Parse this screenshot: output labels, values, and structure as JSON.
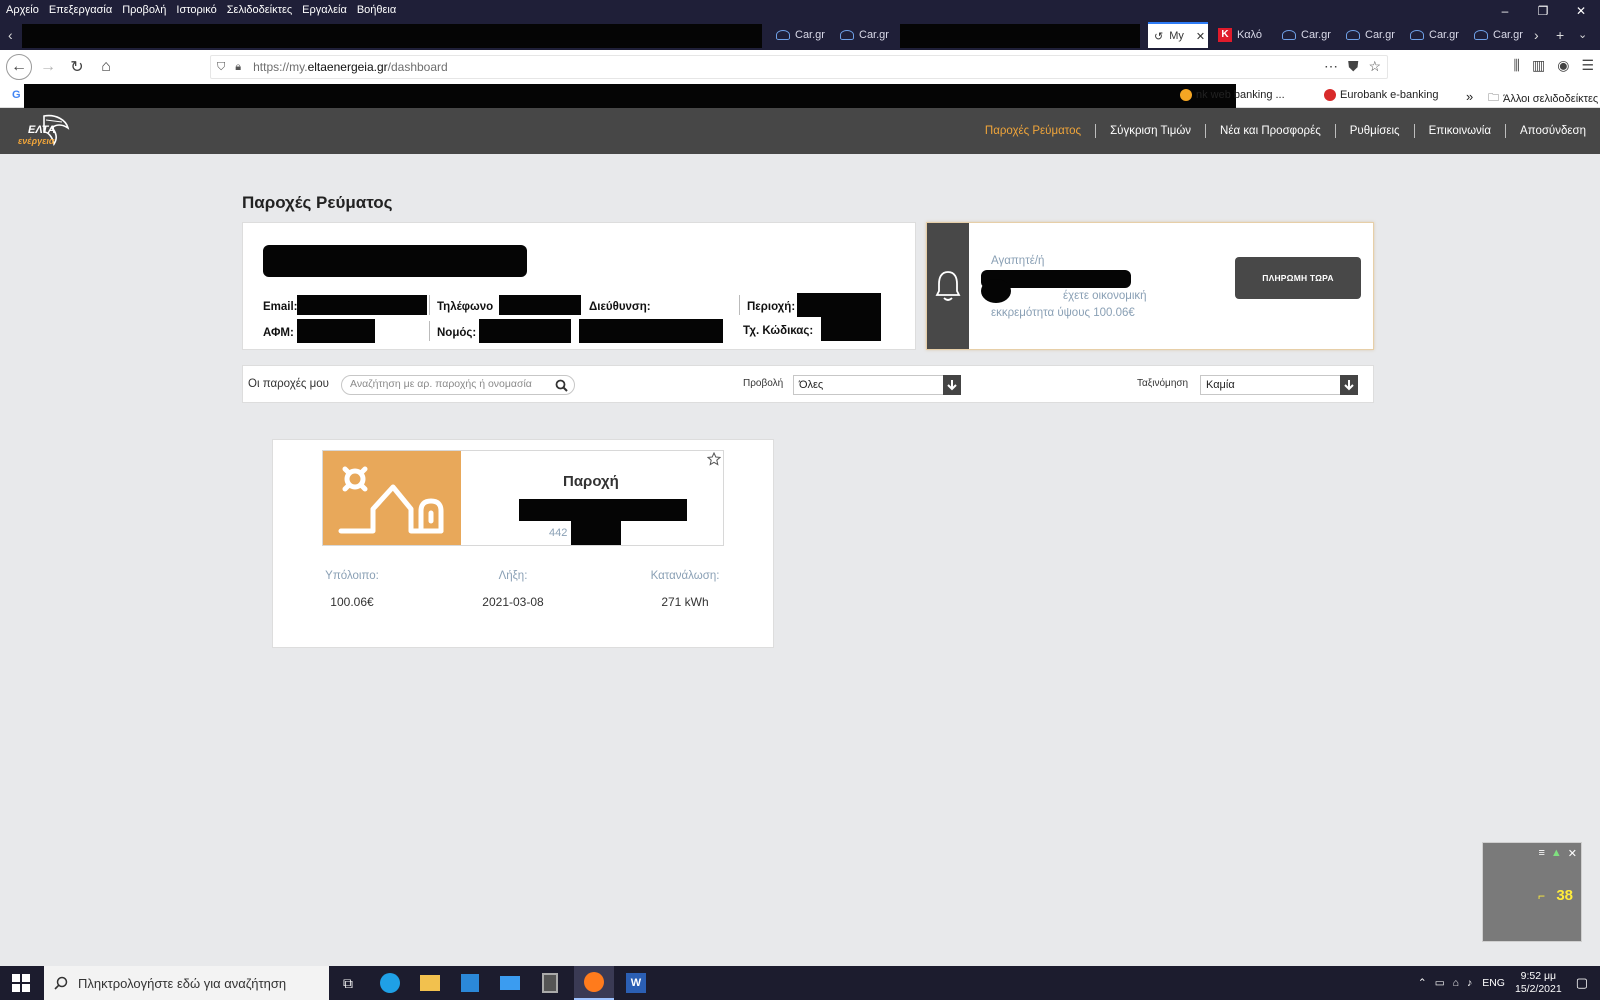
{
  "browser": {
    "menu": [
      "Αρχείο",
      "Επεξεργασία",
      "Προβολή",
      "Ιστορικό",
      "Σελιδοδείκτες",
      "Εργαλεία",
      "Βοήθεια"
    ],
    "tabs": [
      {
        "label": "Car.gr"
      },
      {
        "label": "Car.gr"
      },
      {
        "label": "My"
      },
      {
        "label": "Καλό"
      },
      {
        "label": "Car.gr"
      },
      {
        "label": "Car.gr"
      },
      {
        "label": "Car.gr"
      },
      {
        "label": "Car.gr"
      }
    ],
    "url_prefix": "https://my.",
    "url_domain": "eltaenergeia.gr",
    "url_path": "/dashboard",
    "bookmarks": [
      {
        "label": "nk web banking ..."
      },
      {
        "label": "Eurobank e-banking"
      },
      {
        "label": "Άλλοι σελιδοδείκτες"
      }
    ]
  },
  "site": {
    "logo_line1": "ΕΛΤΑ",
    "logo_line2": "ενέργεια",
    "nav": [
      "Παροχές Ρεύματος",
      "Σύγκριση Τιμών",
      "Νέα και Προσφορές",
      "Ρυθμίσεις",
      "Επικοινωνία",
      "Αποσύνδεση"
    ],
    "accent": "#f0a53a",
    "header_bg": "#474747"
  },
  "page": {
    "title": "Παροχές Ρεύματος",
    "customer": {
      "email_label": "Email:",
      "phone_label": "Τηλέφωνο",
      "address_label": "Διεύθυνση:",
      "region_label": "Περιοχή:",
      "afm_label": "ΑΦΜ:",
      "nomos_label": "Νομός:",
      "tk_label": "Τχ. Κώδικας:"
    },
    "notice": {
      "greeting": "Αγαπητέ/ή",
      "line_a": "έχετε οικονομική",
      "line_b": "εκκρεμότητα ύψους 100.06€",
      "pay_button": "ΠΛΗΡΩΜΗ ΤΩΡΑ"
    },
    "filters": {
      "my_supplies_label": "Οι παροχές μου",
      "search_placeholder": "Αναζήτηση με αρ. παροχής ή ονομασία",
      "view_label": "Προβολή",
      "view_value": "Όλες",
      "sort_label": "Ταξινόμηση",
      "sort_value": "Καμία"
    },
    "supply": {
      "title": "Παροχή",
      "subtitle": "442",
      "balance_label": "Υπόλοιπο:",
      "balance_value": "100.06€",
      "expiry_label": "Λήξη:",
      "expiry_value": "2021-03-08",
      "consumption_label": "Κατανάλωση:",
      "consumption_value": "271 kWh"
    }
  },
  "widget": {
    "value": "38"
  },
  "taskbar": {
    "search_placeholder": "Πληκτρολογήστε εδώ για αναζήτηση",
    "lang": "ENG",
    "time": "9:52 μμ",
    "date": "15/2/2021"
  }
}
